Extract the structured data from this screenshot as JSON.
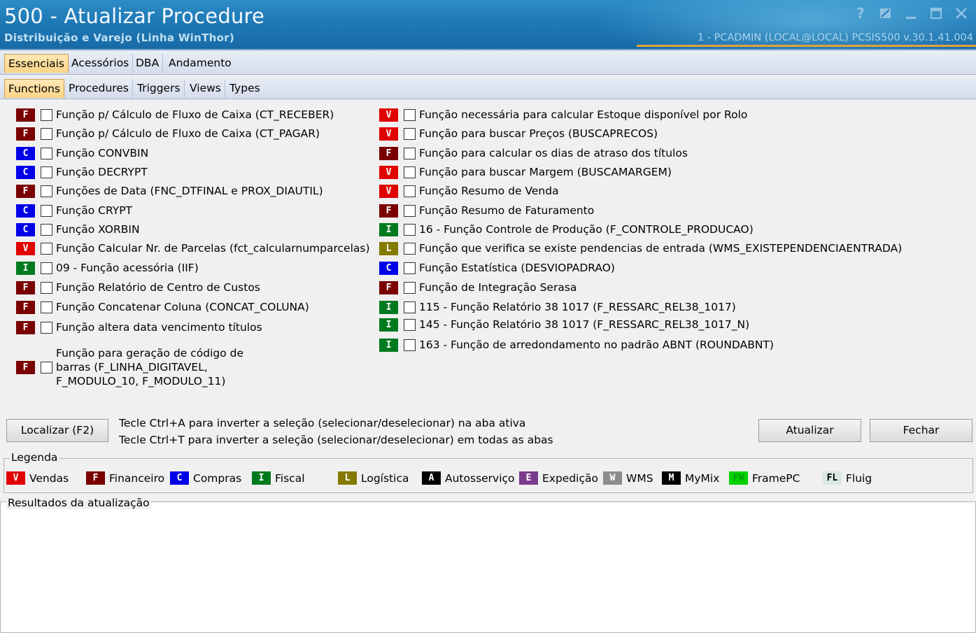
{
  "window": {
    "title": "500 - Atualizar Procedure",
    "subtitle": "Distribuição e Varejo (Linha WinThor)",
    "session": "1 - PCADMIN (LOCAL@LOCAL)   PCSIS500  v.30.1.41.004",
    "buttons": [
      "?",
      "restore",
      "minimize",
      "maximize",
      "close"
    ]
  },
  "tabs": {
    "main": [
      "Essenciais",
      "Acessórios",
      "DBA",
      "Andamento"
    ],
    "sub": [
      "Functions",
      "Procedures",
      "Triggers",
      "Views",
      "Types"
    ],
    "main_active": "Essenciais",
    "sub_active": "Functions"
  },
  "categories": {
    "V": {
      "letter": "V",
      "color": "#e00000",
      "text_color": "#ffffff"
    },
    "F": {
      "letter": "F",
      "color": "#7a0000",
      "text_color": "#ffffff"
    },
    "C": {
      "letter": "C",
      "color": "#0000e8",
      "text_color": "#ffffff"
    },
    "I": {
      "letter": "I",
      "color": "#007a1f",
      "text_color": "#ffffff"
    },
    "L": {
      "letter": "L",
      "color": "#857a00",
      "text_color": "#ffffff"
    },
    "A": {
      "letter": "A",
      "color": "#000000",
      "text_color": "#ffffff"
    },
    "E": {
      "letter": "E",
      "color": "#7a3c8c",
      "text_color": "#ffffff"
    },
    "W": {
      "letter": "W",
      "color": "#8c8c8c",
      "text_color": "#ffffff"
    },
    "M": {
      "letter": "M",
      "color": "#000000",
      "text_color": "#ffffff"
    },
    "FW": {
      "letter": "FW",
      "color": "#00d200",
      "text_color": "#00a000"
    },
    "FL": {
      "letter": "FL",
      "color": "#d9e8e3",
      "text_color": "#000000"
    }
  },
  "functions_left": [
    {
      "cat": "F",
      "label": "Função p/ Cálculo de Fluxo de Caixa (CT_RECEBER)",
      "checked": false
    },
    {
      "cat": "F",
      "label": "Função p/ Cálculo de Fluxo de Caixa (CT_PAGAR)",
      "checked": false
    },
    {
      "cat": "C",
      "label": "Função CONVBIN",
      "checked": false
    },
    {
      "cat": "C",
      "label": "Função DECRYPT",
      "checked": false
    },
    {
      "cat": "F",
      "label": "Funções de Data (FNC_DTFINAL e PROX_DIAUTIL)",
      "checked": false
    },
    {
      "cat": "C",
      "label": "Função CRYPT",
      "checked": false
    },
    {
      "cat": "C",
      "label": "Função XORBIN",
      "checked": false
    },
    {
      "cat": "V",
      "label": "Função Calcular Nr. de Parcelas (fct_calcularnumparcelas)",
      "checked": false
    },
    {
      "cat": "I",
      "label": "09 - Função acessória (IIF)",
      "checked": false
    },
    {
      "cat": "F",
      "label": "Função Relatório de Centro de Custos",
      "checked": false
    },
    {
      "cat": "F",
      "label": "Função Concatenar Coluna (CONCAT_COLUNA)",
      "checked": false
    },
    {
      "cat": "F",
      "label": "Função altera data vencimento títulos",
      "checked": false
    },
    {
      "cat": "F",
      "label": "Função para geração de código de barras (F_LINHA_DIGITAVEL, F_MODULO_10, F_MODULO_11)",
      "checked": false
    }
  ],
  "functions_right": [
    {
      "cat": "V",
      "label": "Função necessária para calcular Estoque disponível por Rolo",
      "checked": false
    },
    {
      "cat": "V",
      "label": "Função para buscar Preços (BUSCAPRECOS)",
      "checked": false
    },
    {
      "cat": "F",
      "label": "Função para calcular os dias de atraso dos títulos",
      "checked": false
    },
    {
      "cat": "V",
      "label": "Função para buscar Margem (BUSCAMARGEM)",
      "checked": false
    },
    {
      "cat": "V",
      "label": "Função Resumo de Venda",
      "checked": false
    },
    {
      "cat": "F",
      "label": "Função Resumo de Faturamento",
      "checked": false
    },
    {
      "cat": "I",
      "label": "16 - Função Controle de Produção (F_CONTROLE_PRODUCAO)",
      "checked": false
    },
    {
      "cat": "L",
      "label": "Função que verifica se existe pendencias de entrada (WMS_EXISTEPENDENCIAENTRADA)",
      "checked": false
    },
    {
      "cat": "C",
      "label": "Função Estatística (DESVIOPADRAO)",
      "checked": false
    },
    {
      "cat": "F",
      "label": "Função de Integração Serasa",
      "checked": false
    },
    {
      "cat": "I",
      "label": "115 - Função Relatório 38 1017 (F_RESSARC_REL38_1017)",
      "checked": false
    },
    {
      "cat": "I",
      "label": "145 - Função Relatório 38 1017 (F_RESSARC_REL38_1017_N)",
      "checked": false
    },
    {
      "cat": "I",
      "label": "163 - Função de arredondamento no padrão ABNT (ROUNDABNT)",
      "checked": false
    }
  ],
  "actions": {
    "find_label": "Localizar (F2)",
    "update_label": "Atualizar",
    "close_label": "Fechar"
  },
  "hints": [
    "Tecle Ctrl+A para inverter a seleção (selecionar/deselecionar) na aba ativa",
    "Tecle Ctrl+T para inverter a seleção (selecionar/deselecionar) em todas as abas"
  ],
  "legend": {
    "title": "Legenda",
    "items": [
      {
        "cat": "V",
        "label": "Vendas"
      },
      {
        "cat": "F",
        "label": "Financeiro"
      },
      {
        "cat": "C",
        "label": "Compras"
      },
      {
        "cat": "I",
        "label": "Fiscal"
      },
      {
        "cat": "L",
        "label": "Logística"
      },
      {
        "cat": "A",
        "label": "Autosserviço"
      },
      {
        "cat": "E",
        "label": "Expedição"
      },
      {
        "cat": "W",
        "label": "WMS"
      },
      {
        "cat": "M",
        "label": "MyMix"
      },
      {
        "cat": "FW",
        "label": "FramePC"
      },
      {
        "cat": "FL",
        "label": "Fluig"
      }
    ]
  },
  "results": {
    "title": "Resultados da atualização"
  }
}
